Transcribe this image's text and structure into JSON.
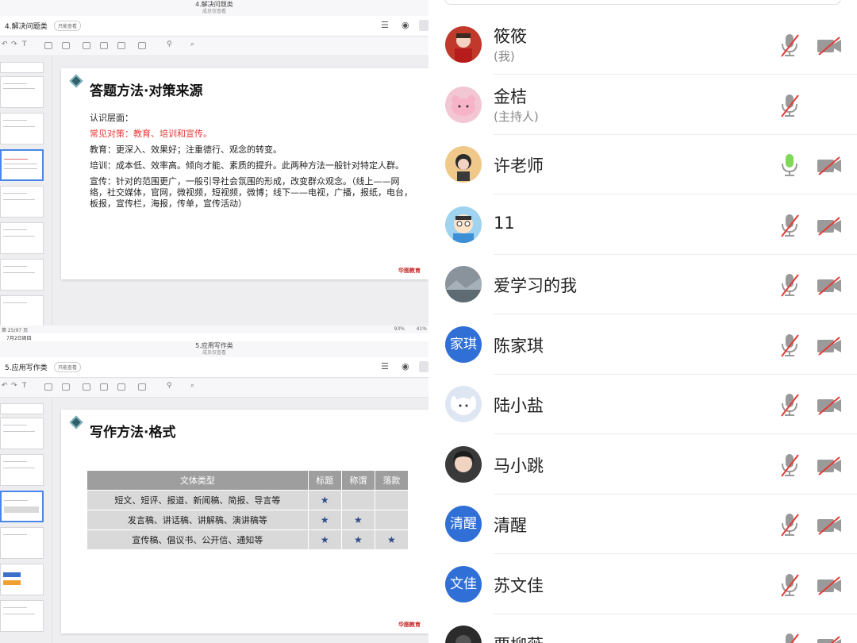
{
  "top_pane": {
    "window_title": "4.解决问题类",
    "window_subtitle": "成员仅查看",
    "doc_name": "4.解决问题类",
    "view_badge": "只能查看",
    "slide_title": "答题方法·对策来源",
    "paragraphs": [
      {
        "text": "认识层面：",
        "color": "normal"
      },
      {
        "text": "常见对策：教育、培训和宣传。",
        "color": "red"
      },
      {
        "text": "教育：更深入、效果好；注重德行、观念的转变。",
        "color": "normal"
      },
      {
        "text": "培训：成本低、效率高。倾向才能、素质的提升。此两种方法一般针对特定人群。",
        "color": "normal"
      },
      {
        "text": "宣传：针对的范围更广，一般引导社会氛围的形成，改变群众观念。（线上——网络，社交媒体，官网，微视频，短视频，微博；线下——电视，广播，报纸，电台，板报，宣传栏，海报，传单，宣传活动）",
        "color": "normal"
      }
    ],
    "logo_text": "华图教育",
    "status_left": "第 25/97 页",
    "status_zoom": "93%",
    "status_battery": "41%",
    "status_date": "7月2日周四"
  },
  "bottom_pane": {
    "window_title": "5.应用写作类",
    "window_subtitle": "成员仅查看",
    "doc_name": "5.应用写作类",
    "view_badge": "只能查看",
    "slide_title": "写作方法·格式",
    "table": {
      "headers": [
        "文体类型",
        "标题",
        "称谓",
        "落款"
      ],
      "rows": [
        [
          "短文、短评、报道、新闻稿、简报、导言等",
          "★",
          "",
          ""
        ],
        [
          "发言稿、讲话稿、讲解稿、演讲稿等",
          "★",
          "★",
          ""
        ],
        [
          "宣传稿、倡议书、公开信、通知等",
          "★",
          "★",
          "★"
        ]
      ]
    },
    "logo_text": "华图教育"
  },
  "participants": [
    {
      "name": "筱筱",
      "sub": "(我)",
      "avatar": "photo-girl",
      "avatar_color": "#c0392b",
      "mic": "muted",
      "camera": "off"
    },
    {
      "name": "金桔",
      "sub": "(主持人)",
      "avatar": "pink-bear",
      "avatar_color": "#f3c6d3",
      "mic": "muted",
      "camera": "none"
    },
    {
      "name": "许老师",
      "sub": "",
      "avatar": "cartoon-boy",
      "avatar_color": "#f0c98a",
      "mic": "active",
      "camera": "off"
    },
    {
      "name": "11",
      "sub": "",
      "avatar": "cartoon-kid",
      "avatar_color": "#9fd3f0",
      "mic": "muted",
      "camera": "off"
    },
    {
      "name": "爱学习的我",
      "sub": "",
      "avatar": "landscape",
      "avatar_color": "#8a939c",
      "mic": "muted",
      "camera": "off"
    },
    {
      "name": "陈家琪",
      "sub": "",
      "avatar": "text",
      "avatar_text": "家琪",
      "avatar_color": "#2f6fd6",
      "mic": "muted",
      "camera": "off"
    },
    {
      "name": "陆小盐",
      "sub": "",
      "avatar": "white-dog",
      "avatar_color": "#dfe6f3",
      "mic": "muted",
      "camera": "off"
    },
    {
      "name": "马小跳",
      "sub": "",
      "avatar": "photo-woman",
      "avatar_color": "#3a3a3a",
      "mic": "muted",
      "camera": "off"
    },
    {
      "name": "清醒",
      "sub": "",
      "avatar": "text",
      "avatar_text": "清醒",
      "avatar_color": "#2f6fd6",
      "mic": "muted",
      "camera": "off"
    },
    {
      "name": "苏文佳",
      "sub": "",
      "avatar": "text",
      "avatar_text": "文佳",
      "avatar_color": "#2f6fd6",
      "mic": "muted",
      "camera": "off"
    },
    {
      "name": "贾柳薇",
      "sub": "",
      "avatar": "dark-photo",
      "avatar_color": "#2b2b2b",
      "mic": "muted",
      "camera": "off"
    }
  ],
  "colors": {
    "mic_active": "#7ed957",
    "muted_slash": "#e53935",
    "icon_gray": "#9a9a9a",
    "text_avatar": "#2f6fd6",
    "slide_red": "#e53935"
  }
}
